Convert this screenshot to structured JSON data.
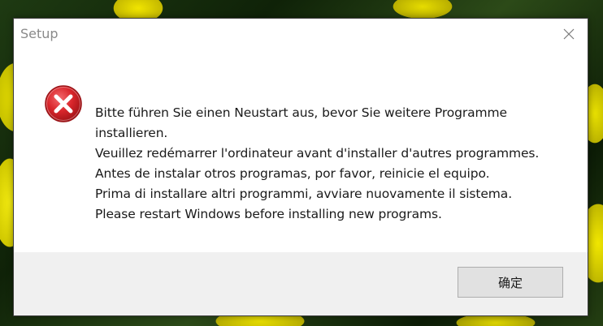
{
  "window": {
    "title": "Setup",
    "close_icon": "close-icon"
  },
  "message": {
    "icon": "error-icon",
    "lines": [
      "Bitte führen Sie einen Neustart aus, bevor Sie weitere Programme",
      "installieren.",
      "Veuillez redémarrer l'ordinateur avant d'installer d'autres programmes.",
      "Antes de instalar otros programas, por favor, reinicie el equipo.",
      "Prima di installare altri programmi, avviare nuovamente il sistema.",
      "Please restart Windows before installing new programs."
    ]
  },
  "buttons": {
    "ok_label": "确定"
  },
  "colors": {
    "error_red": "#d9262b",
    "button_bg": "#e1e1e1",
    "footer_bg": "#f0f0f0"
  }
}
